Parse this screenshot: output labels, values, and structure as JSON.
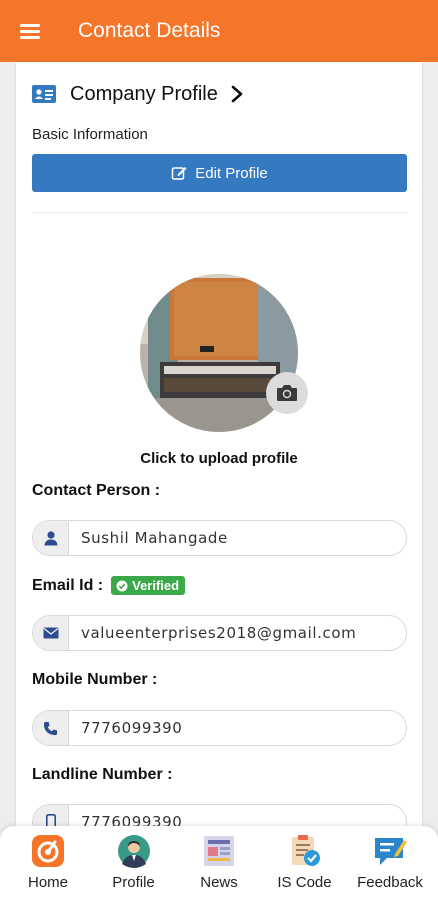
{
  "header": {
    "title": "Contact Details"
  },
  "section": {
    "title": "Company Profile",
    "subtitle": "Basic Information",
    "edit_label": "Edit Profile"
  },
  "avatar": {
    "upload_label": "Click to upload profile"
  },
  "fields": [
    {
      "label": "Contact Person :",
      "value": "Sushil Mahangade",
      "icon": "user-icon"
    },
    {
      "label": "Email Id :",
      "badge": "Verified",
      "value": "valueenterprises2018@gmail.com",
      "icon": "envelope-icon"
    },
    {
      "label": "Mobile Number :",
      "value": "7776099390",
      "icon": "phone-icon"
    },
    {
      "label": "Landline Number :",
      "value": "7776099390",
      "icon": "mobile-icon"
    }
  ],
  "nav": [
    {
      "label": "Home",
      "icon": "home-icon"
    },
    {
      "label": "Profile",
      "icon": "profile-icon"
    },
    {
      "label": "News",
      "icon": "news-icon"
    },
    {
      "label": "IS Code",
      "icon": "is-code-icon"
    },
    {
      "label": "Feedback",
      "icon": "feedback-icon"
    }
  ],
  "colors": {
    "primary": "#f5762a",
    "button": "#3579c0",
    "verified": "#3ba84a"
  }
}
